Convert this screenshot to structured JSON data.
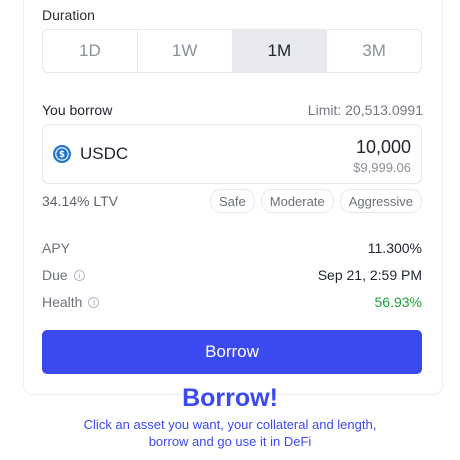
{
  "duration": {
    "label": "Duration",
    "options": [
      "1D",
      "1W",
      "1M",
      "3M"
    ],
    "selected": "1M"
  },
  "borrow": {
    "label": "You borrow",
    "limit_text": "Limit: 20,513.0991",
    "asset": {
      "name": "USDC",
      "icon": "usdc-icon"
    },
    "amount": "10,000",
    "amount_usd": "$9,999.06"
  },
  "ltv": {
    "text": "34.14% LTV",
    "risk_options": [
      "Safe",
      "Moderate",
      "Aggressive"
    ]
  },
  "stats": {
    "apy_label": "APY",
    "apy_value": "11.300%",
    "due_label": "Due",
    "due_value": "Sep 21, 2:59 PM",
    "health_label": "Health",
    "health_value": "56.93%",
    "health_color": "#1aa33a"
  },
  "action": {
    "button_label": "Borrow",
    "color": "#3a4af0"
  },
  "hero": {
    "title": "Borrow!",
    "line1": "Click an asset you want, your collateral and length,",
    "line2": "borrow and go use it in DeFi"
  }
}
